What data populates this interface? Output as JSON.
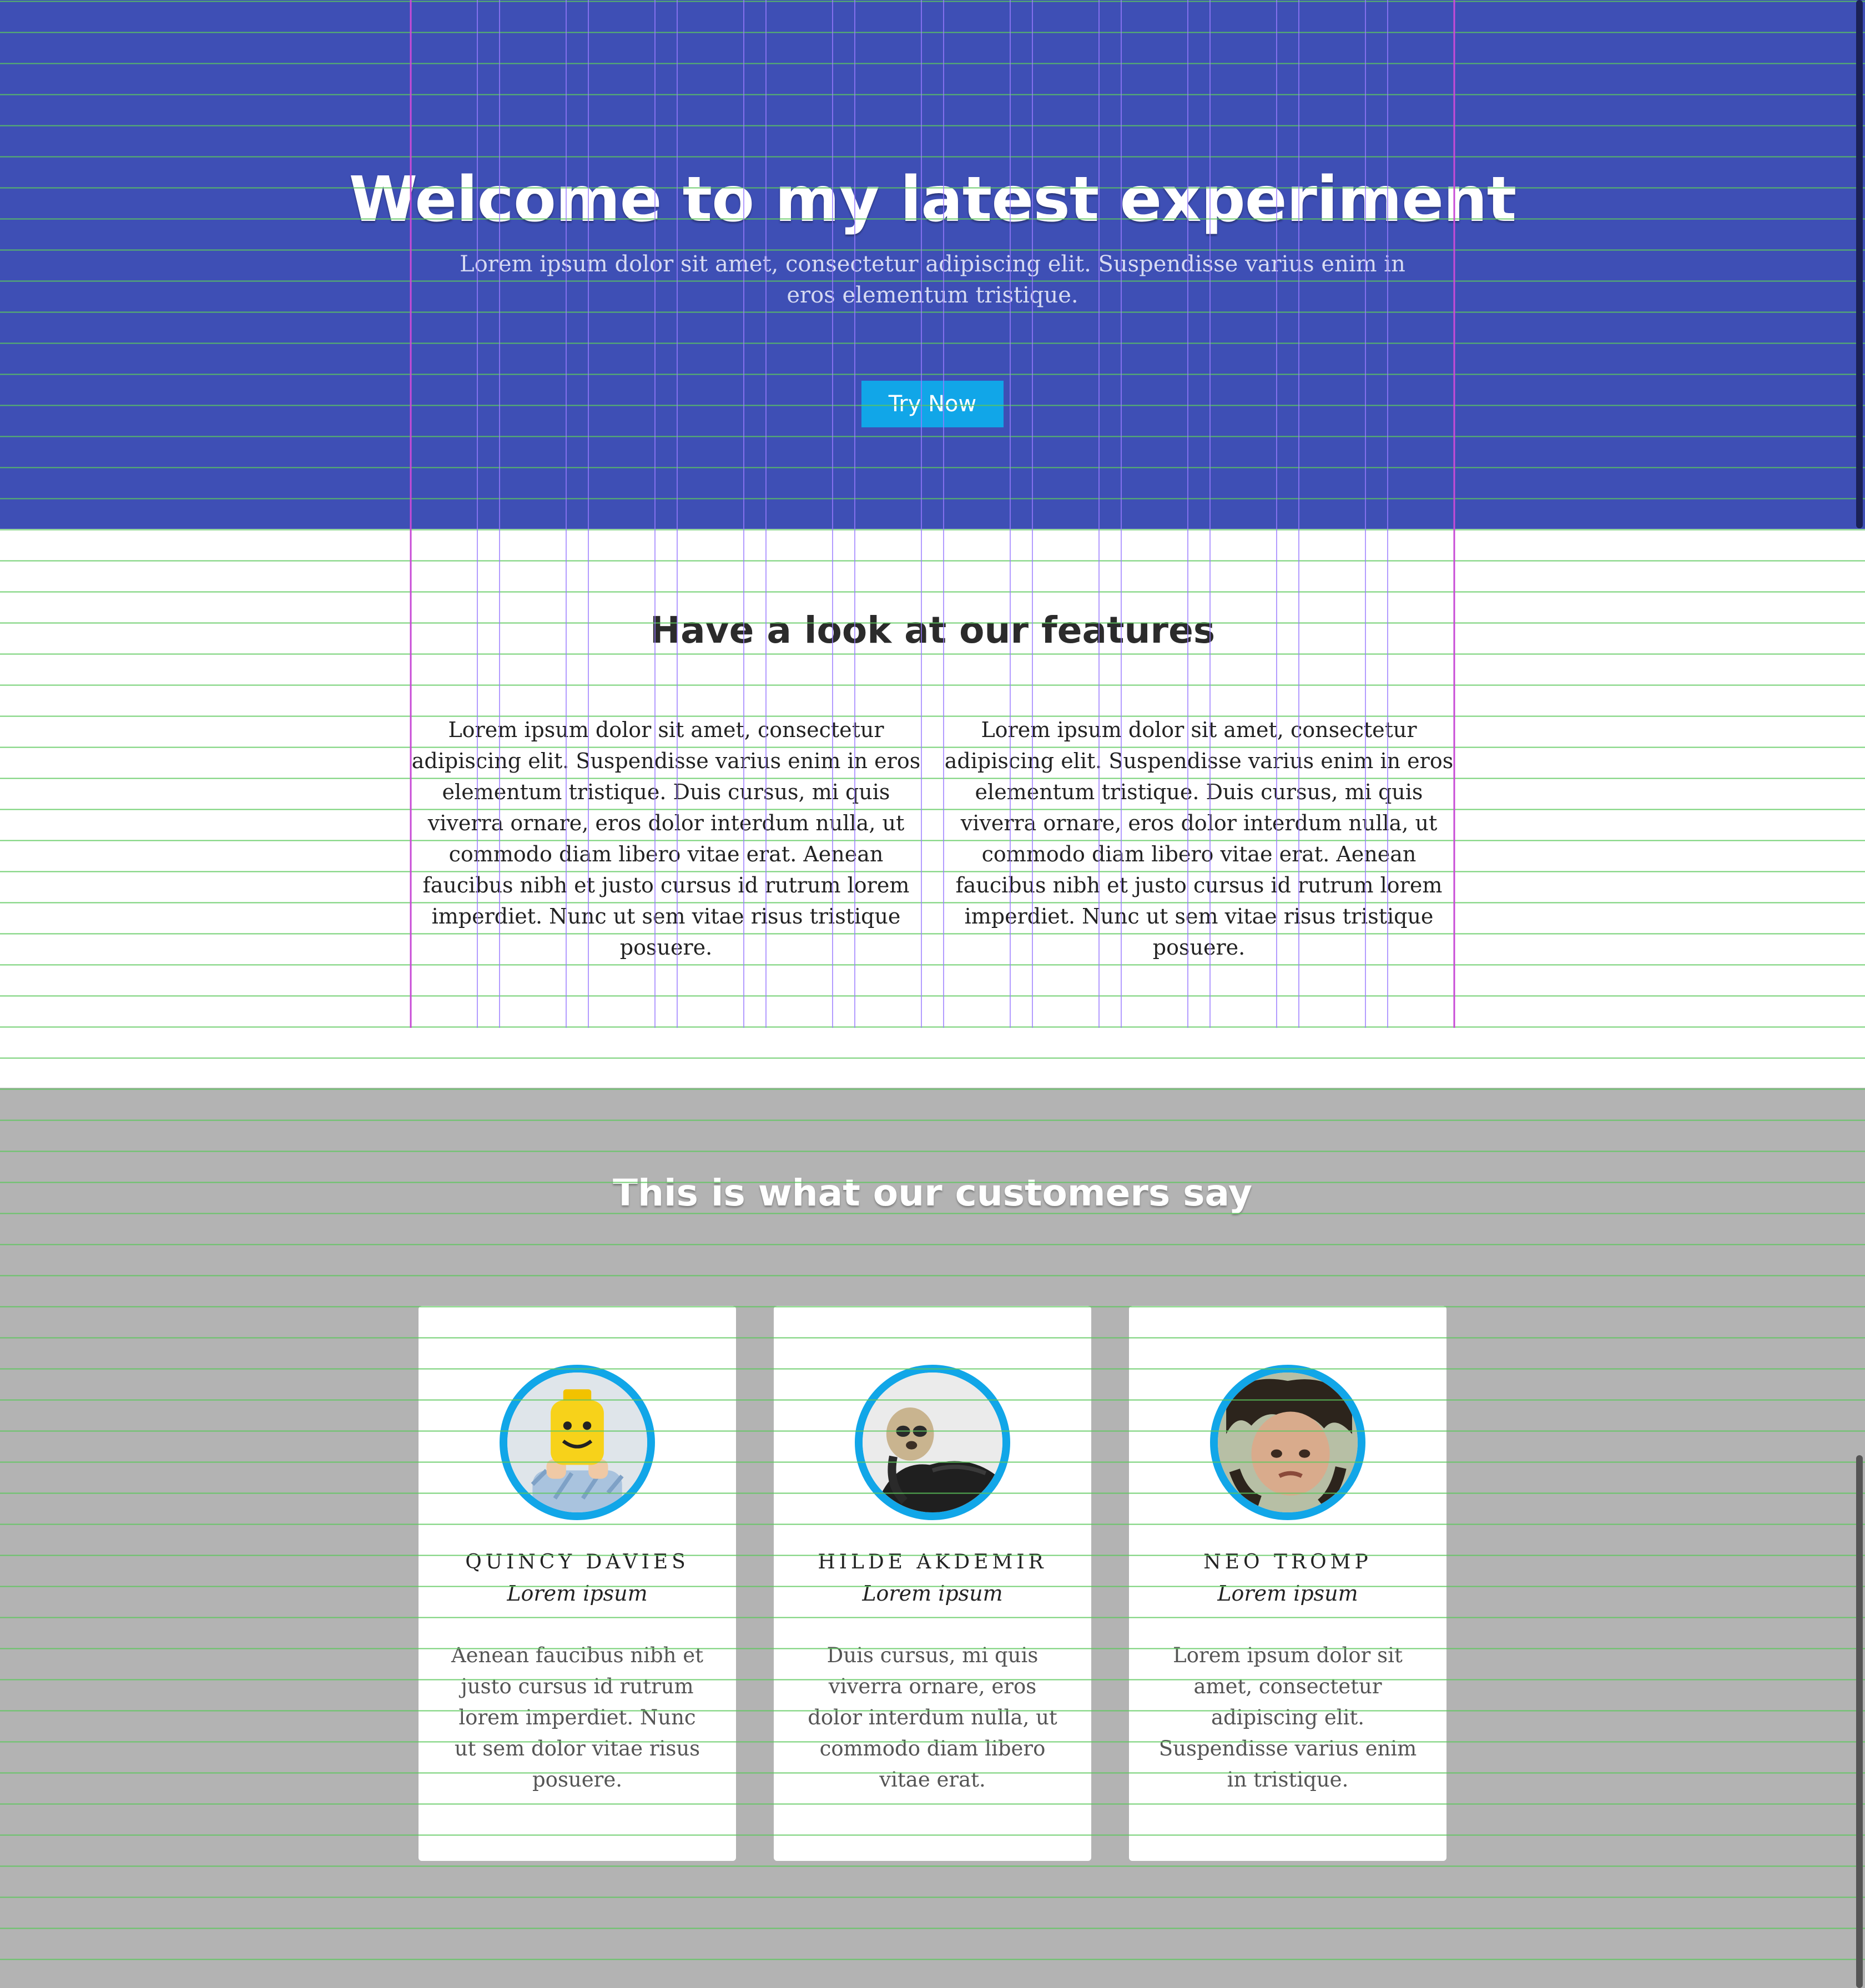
{
  "hero": {
    "title": "Welcome to my latest experiment",
    "subtitle": "Lorem ipsum dolor sit amet, consectetur adipiscing elit. Suspendisse varius enim in eros elementum tristique.",
    "cta_label": "Try Now",
    "background_color": "#3e4fb5",
    "cta_color": "#11a6e8"
  },
  "features": {
    "title": "Have a look at our features",
    "columns": [
      {
        "text": "Lorem ipsum dolor sit amet, consectetur adipiscing elit. Suspendisse varius enim in eros elementum tristique. Duis cursus, mi quis viverra ornare, eros dolor interdum nulla, ut commodo diam libero vitae erat. Aenean faucibus nibh et justo cursus id rutrum lorem imperdiet. Nunc ut sem vitae risus tristique posuere."
      },
      {
        "text": "Lorem ipsum dolor sit amet, consectetur adipiscing elit. Suspendisse varius enim in eros elementum tristique. Duis cursus, mi quis viverra ornare, eros dolor interdum nulla, ut commodo diam libero vitae erat. Aenean faucibus nibh et justo cursus id rutrum lorem imperdiet. Nunc ut sem vitae risus tristique posuere."
      }
    ]
  },
  "testimonials": {
    "title": "This is what our customers say",
    "background_color": "#b3b3b3",
    "avatar_ring_color": "#11a6e8",
    "cards": [
      {
        "name": "QUINCY DAVIES",
        "role": "Lorem ipsum",
        "quote": "Aenean faucibus nibh et justo cursus id rutrum lorem imperdiet. Nunc ut sem dolor vitae risus posuere.",
        "avatar_icon": "lego-head-avatar"
      },
      {
        "name": "HILDE AKDEMIR",
        "role": "Lorem ipsum",
        "quote": "Duis cursus, mi quis viverra ornare, eros dolor interdum nulla, ut commodo diam libero vitae erat.",
        "avatar_icon": "sloth-avatar"
      },
      {
        "name": "NEO TROMP",
        "role": "Lorem ipsum",
        "quote": "Lorem ipsum dolor sit amet, consectetur adipiscing elit. Suspendisse varius enim in tristique.",
        "avatar_icon": "upside-down-face-avatar"
      }
    ]
  },
  "overlay": {
    "baseline_grid_color": "#5cc85c",
    "column_grid_color": "#9a7cff",
    "container_edge_color": "#c84bd6"
  }
}
